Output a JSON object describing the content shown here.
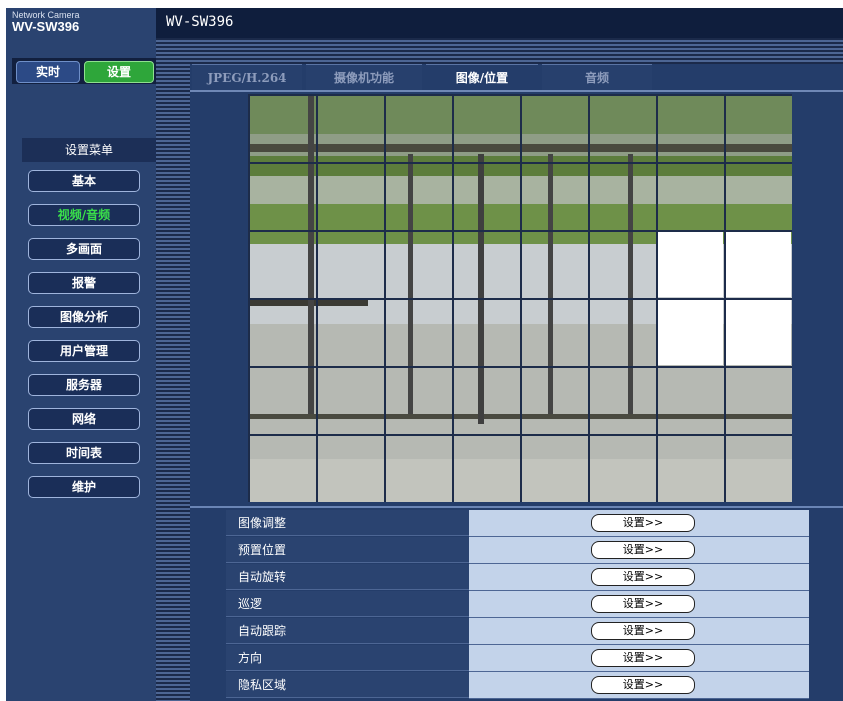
{
  "header": {
    "brand_line1": "Network Camera",
    "brand_line2": "WV-SW396",
    "model": "WV-SW396"
  },
  "mode": {
    "live_label": "实时",
    "setup_label": "设置"
  },
  "menu": {
    "title": "设置菜单",
    "items": [
      {
        "label": "基本",
        "active": false
      },
      {
        "label": "视频/音频",
        "active": true
      },
      {
        "label": "多画面",
        "active": false
      },
      {
        "label": "报警",
        "active": false
      },
      {
        "label": "图像分析",
        "active": false
      },
      {
        "label": "用户管理",
        "active": false
      },
      {
        "label": "服务器",
        "active": false
      },
      {
        "label": "网络",
        "active": false
      },
      {
        "label": "时间表",
        "active": false
      },
      {
        "label": "维护",
        "active": false
      }
    ]
  },
  "tabs": [
    {
      "label": "JPEG/H.264",
      "active": false
    },
    {
      "label": "摄像机功能",
      "active": false
    },
    {
      "label": "图像/位置",
      "active": true
    },
    {
      "label": "音频",
      "active": false
    }
  ],
  "settings": [
    {
      "label": "图像调整",
      "button": "设置>>"
    },
    {
      "label": "预置位置",
      "button": "设置>>"
    },
    {
      "label": "自动旋转",
      "button": "设置>>"
    },
    {
      "label": "巡逻",
      "button": "设置>>"
    },
    {
      "label": "自动跟踪",
      "button": "设置>>"
    },
    {
      "label": "方向",
      "button": "设置>>"
    },
    {
      "label": "隐私区域",
      "button": "设置>>"
    }
  ],
  "colors": {
    "active_menu": "#39e04a",
    "setup_button": "#2ea63a",
    "background": "#2a4370"
  }
}
